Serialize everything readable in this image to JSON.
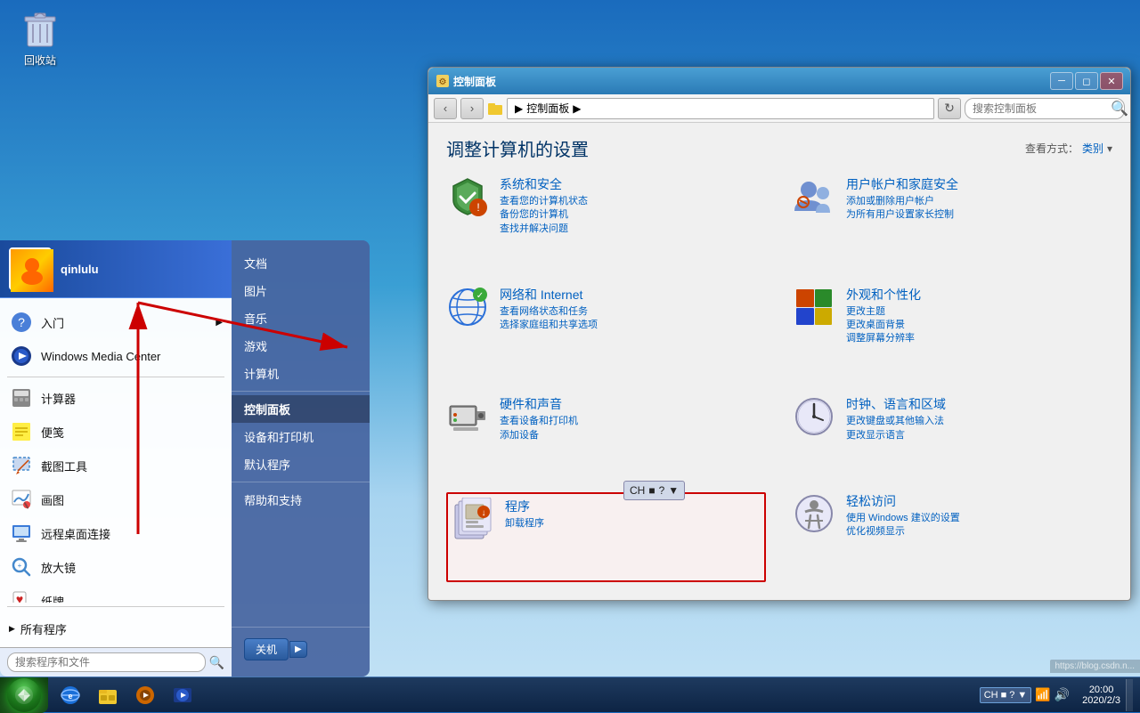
{
  "desktop": {
    "recycle_bin_label": "回收站"
  },
  "start_menu": {
    "user_name": "qinlulu",
    "items_top": [
      {
        "label": "入门",
        "has_arrow": true,
        "icon": "getstarted"
      },
      {
        "label": "Windows Media Center",
        "has_arrow": false,
        "icon": "wmc"
      }
    ],
    "items_bottom": [
      {
        "label": "计算器",
        "has_arrow": false,
        "icon": "calc"
      },
      {
        "label": "便笺",
        "has_arrow": false,
        "icon": "stickynotes"
      },
      {
        "label": "截图工具",
        "has_arrow": false,
        "icon": "snipping"
      },
      {
        "label": "画图",
        "has_arrow": false,
        "icon": "paint"
      },
      {
        "label": "远程桌面连接",
        "has_arrow": false,
        "icon": "remote"
      },
      {
        "label": "放大镜",
        "has_arrow": false,
        "icon": "magnifier"
      },
      {
        "label": "纸牌",
        "has_arrow": false,
        "icon": "solitaire"
      }
    ],
    "all_programs_label": "所有程序",
    "search_placeholder": "搜索程序和文件",
    "right_items": [
      {
        "label": "文档"
      },
      {
        "label": "图片"
      },
      {
        "label": "音乐"
      },
      {
        "label": "游戏"
      },
      {
        "label": "计算机"
      },
      {
        "label": "控制面板",
        "active": true
      },
      {
        "label": "设备和打印机"
      },
      {
        "label": "默认程序"
      },
      {
        "label": "帮助和支持"
      }
    ],
    "shutdown_label": "关机",
    "shutdown_arrow": "▶"
  },
  "control_panel": {
    "title": "控制面板",
    "window_title": "控制面板",
    "address_bar": "控制面板",
    "breadcrumb": "控制面板",
    "search_placeholder": "搜索控制面板",
    "main_title": "调整计算机的设置",
    "view_label": "查看方式：",
    "view_option": "类别",
    "items": [
      {
        "title": "系统和安全",
        "links": [
          "查看您的计算机状态",
          "备份您的计算机",
          "查找并解决问题"
        ],
        "icon": "shield"
      },
      {
        "title": "用户帐户和家庭安全",
        "links": [
          "添加或删除用户帐户",
          "为所有用户设置家长控制"
        ],
        "icon": "users"
      },
      {
        "title": "网络和 Internet",
        "links": [
          "查看网络状态和任务",
          "选择家庭组和共享选项"
        ],
        "icon": "network"
      },
      {
        "title": "外观和个性化",
        "links": [
          "更改主题",
          "更改桌面背景",
          "调整屏幕分辨率"
        ],
        "icon": "appearance"
      },
      {
        "title": "硬件和声音",
        "links": [
          "查看设备和打印机",
          "添加设备"
        ],
        "icon": "hardware"
      },
      {
        "title": "时钟、语言和区域",
        "links": [
          "更改键盘或其他输入法",
          "更改显示语言"
        ],
        "icon": "clock"
      },
      {
        "title": "程序",
        "links": [
          "卸载程序"
        ],
        "icon": "programs",
        "highlighted": true
      },
      {
        "title": "轻松访问",
        "links": [
          "使用 Windows 建议的设置",
          "优化视频显示"
        ],
        "icon": "accessibility"
      }
    ]
  },
  "ime_bar": {
    "lang": "CH",
    "buttons": [
      "■",
      "?",
      "▼"
    ]
  },
  "taskbar": {
    "time": "20:00",
    "date": "2020/2/3",
    "url": "https://blog.csdn.n...",
    "icons": [
      "ie",
      "explorer",
      "wmp",
      "wmc"
    ]
  }
}
